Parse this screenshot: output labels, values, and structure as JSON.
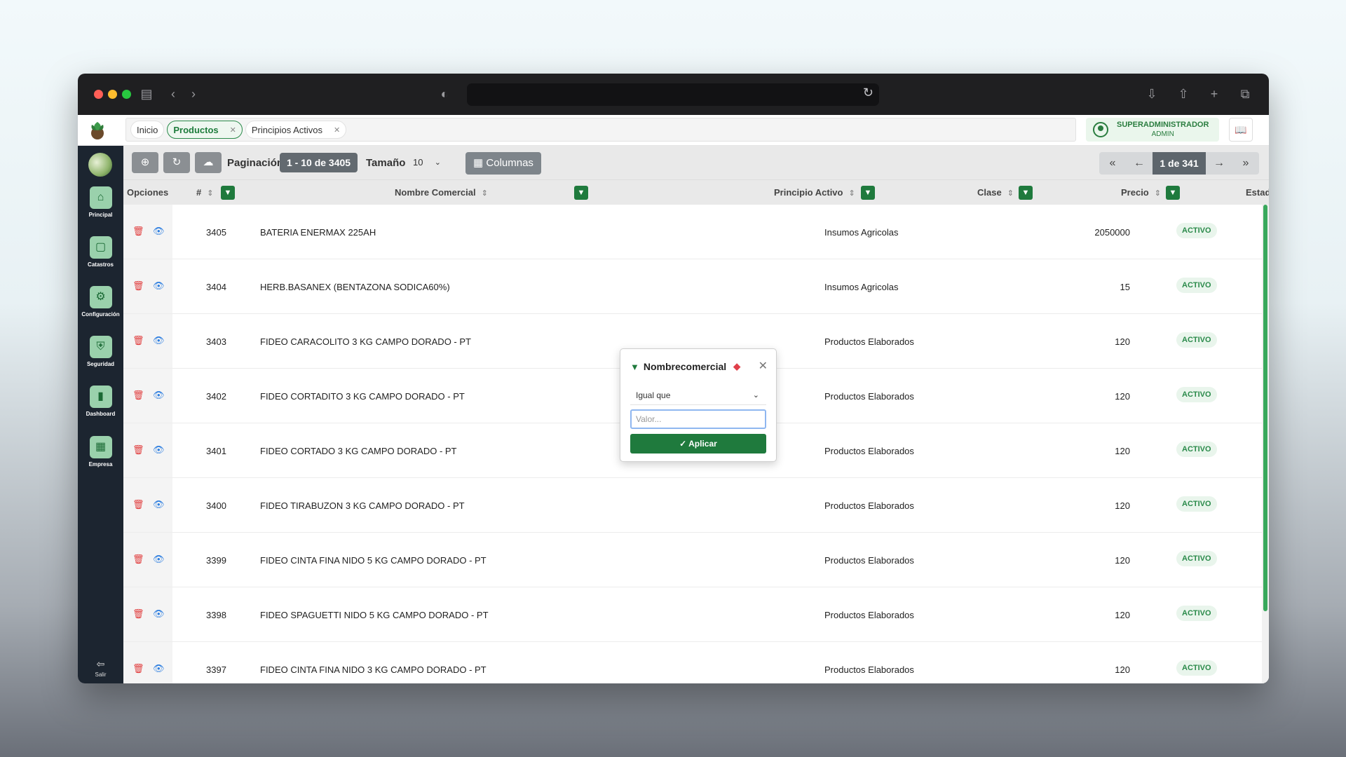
{
  "tabs": [
    {
      "label": "Inicio"
    },
    {
      "label": "Productos"
    },
    {
      "label": "Principios Activos"
    }
  ],
  "user": {
    "name": "SUPERADMINISTRADOR",
    "role": "ADMIN"
  },
  "sidebar": {
    "items": [
      {
        "label": "Principal",
        "icon": "home-icon"
      },
      {
        "label": "Catastros",
        "icon": "cube-icon"
      },
      {
        "label": "Configuración",
        "icon": "gear-icon"
      },
      {
        "label": "Seguridad",
        "icon": "shield-icon"
      },
      {
        "label": "Dashboard",
        "icon": "bar-chart-icon"
      },
      {
        "label": "Empresa",
        "icon": "building-icon"
      }
    ],
    "exit_label": "Salir"
  },
  "toolbar": {
    "pagination_label": "Paginación",
    "range": "1 - 10 de 3405",
    "size_label": "Tamaño",
    "size_value": "10",
    "columns_label": "Columnas",
    "page_indicator": "1 de 341"
  },
  "table": {
    "headers": {
      "options": "Opciones",
      "id": "#",
      "name": "Nombre Comercial",
      "active": "Principio Activo",
      "class": "Clase",
      "price": "Precio",
      "status": "Estado"
    },
    "rows": [
      {
        "id": "3405",
        "name": "BATERIA ENERMAX 225AH",
        "active": "",
        "class": "Insumos Agricolas",
        "price": "2050000",
        "status": "ACTIVO"
      },
      {
        "id": "3404",
        "name": "HERB.BASANEX (BENTAZONA SODICA60%)",
        "active": "",
        "class": "Insumos Agricolas",
        "price": "15",
        "status": "ACTIVO"
      },
      {
        "id": "3403",
        "name": "FIDEO CARACOLITO 3 KG CAMPO DORADO - PT",
        "active": "",
        "class": "Productos Elaborados",
        "price": "120",
        "status": "ACTIVO"
      },
      {
        "id": "3402",
        "name": "FIDEO CORTADITO 3 KG CAMPO DORADO - PT",
        "active": "",
        "class": "Productos Elaborados",
        "price": "120",
        "status": "ACTIVO"
      },
      {
        "id": "3401",
        "name": "FIDEO CORTADO 3 KG CAMPO DORADO - PT",
        "active": "",
        "class": "Productos Elaborados",
        "price": "120",
        "status": "ACTIVO"
      },
      {
        "id": "3400",
        "name": "FIDEO TIRABUZON 3 KG CAMPO DORADO - PT",
        "active": "",
        "class": "Productos Elaborados",
        "price": "120",
        "status": "ACTIVO"
      },
      {
        "id": "3399",
        "name": "FIDEO CINTA FINA NIDO 5 KG CAMPO DORADO - PT",
        "active": "",
        "class": "Productos Elaborados",
        "price": "120",
        "status": "ACTIVO"
      },
      {
        "id": "3398",
        "name": "FIDEO SPAGUETTI NIDO 5 KG CAMPO DORADO - PT",
        "active": "",
        "class": "Productos Elaborados",
        "price": "120",
        "status": "ACTIVO"
      },
      {
        "id": "3397",
        "name": "FIDEO CINTA FINA NIDO 3 KG CAMPO DORADO - PT",
        "active": "",
        "class": "Productos Elaborados",
        "price": "120",
        "status": "ACTIVO"
      }
    ]
  },
  "filter_popup": {
    "title": "Nombrecomercial",
    "operator": "Igual que",
    "value_placeholder": "Valor...",
    "apply_label": "Aplicar"
  },
  "colors": {
    "accent": "#1f7a3d",
    "status_text": "#2a8a4a",
    "delete": "#e03b3b",
    "view": "#2f7fe0"
  }
}
